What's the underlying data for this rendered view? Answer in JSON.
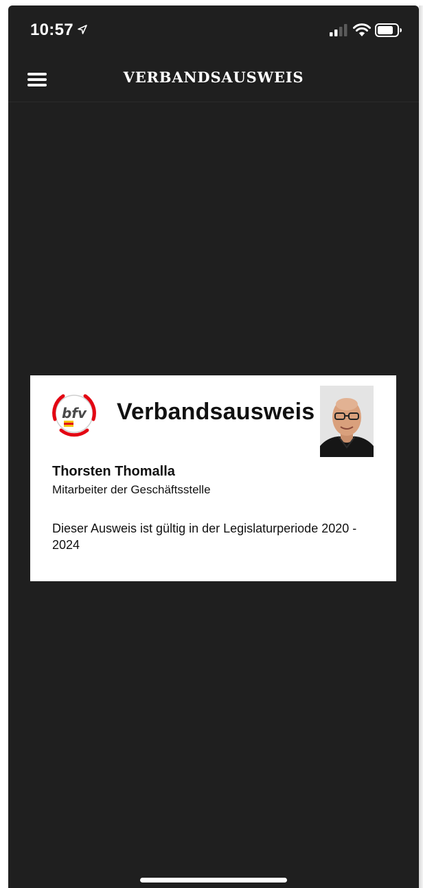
{
  "status_bar": {
    "time": "10:57",
    "icons": [
      "location-arrow-icon",
      "cellular-signal-icon",
      "wifi-icon",
      "battery-icon"
    ]
  },
  "nav": {
    "title": "VERBANDSAUSWEIS",
    "menu_icon": "hamburger-menu-icon"
  },
  "card": {
    "title": "Verbandsausweis",
    "logo_text": "bfv",
    "holder": {
      "name": "Thorsten Thomalla",
      "role": "Mitarbeiter der Geschäftsstelle"
    },
    "validity": "Dieser Ausweis ist gültig in der Legislaturperiode 2020 - 2024"
  },
  "colors": {
    "background": "#1f1f1f",
    "card_background": "#ffffff",
    "text_on_dark": "#ffffff",
    "brand_red": "#e30613",
    "brand_gold": "#f4c20d"
  }
}
